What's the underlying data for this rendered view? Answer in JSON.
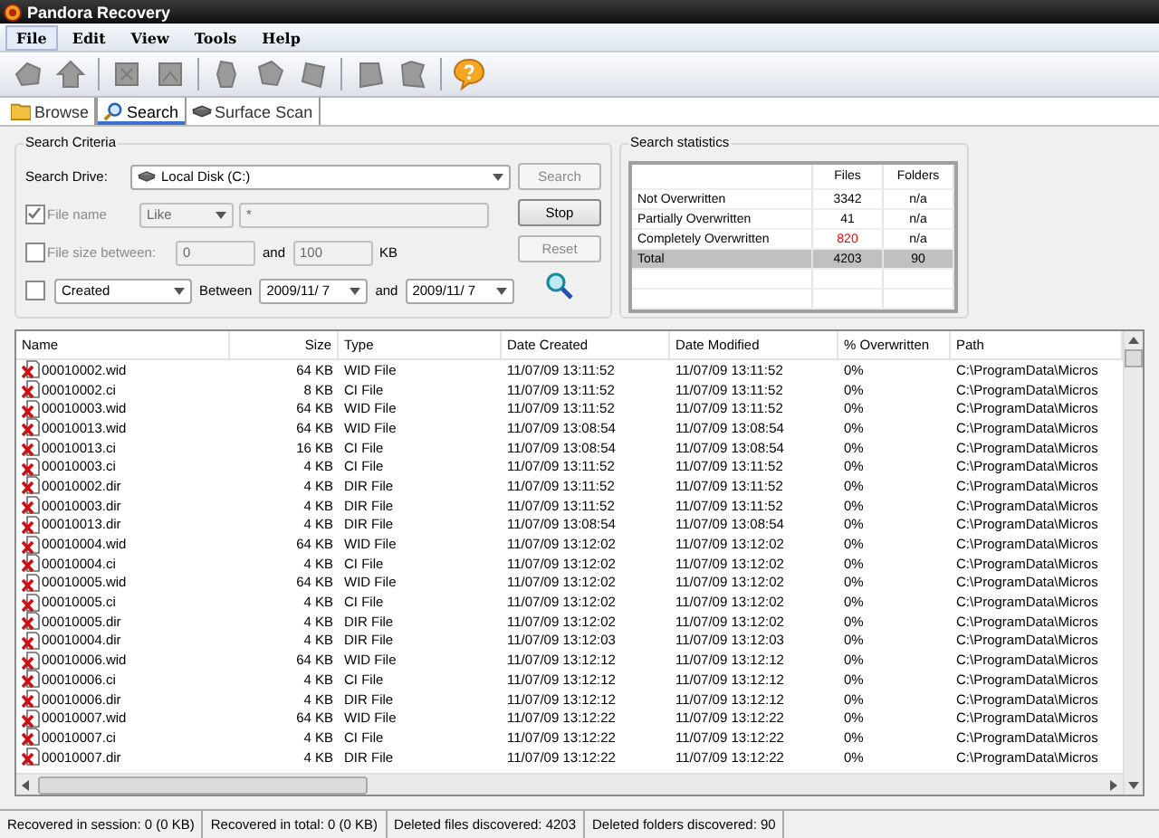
{
  "window": {
    "title": "Pandora Recovery"
  },
  "menu": [
    {
      "label": "File",
      "selected": true
    },
    {
      "label": "Edit",
      "selected": false
    },
    {
      "label": "View",
      "selected": false
    },
    {
      "label": "Tools",
      "selected": false
    },
    {
      "label": "Help",
      "selected": false
    }
  ],
  "tabs": [
    {
      "label": "Browse",
      "kind": "folder",
      "selected": false
    },
    {
      "label": "Search",
      "kind": "search",
      "selected": true
    },
    {
      "label": "Surface Scan",
      "kind": "disk",
      "selected": false
    }
  ],
  "search_criteria": {
    "title": "Search Criteria",
    "drive_label": "Search Drive:",
    "drive": "Local Disk (C:)",
    "file_name": {
      "label": "File name",
      "checked": true,
      "disabled": true,
      "match": "Like",
      "value": "*"
    },
    "file_size": {
      "label": "File size between:",
      "checked": false,
      "disabled": true,
      "min": "0",
      "and": "and",
      "max": "100",
      "unit": "KB"
    },
    "date": {
      "checked": false,
      "field": "Created",
      "between": "Between",
      "from": "2009/11/ 7",
      "and": "and",
      "to": "2009/11/ 7"
    },
    "buttons": [
      {
        "label": "Search",
        "disabled": true
      },
      {
        "label": "Stop",
        "disabled": false
      },
      {
        "label": "Reset",
        "disabled": true
      }
    ]
  },
  "search_statistics": {
    "title": "Search statistics",
    "columns": [
      "Files",
      "Folders"
    ],
    "rows": [
      {
        "label": "Not Overwritten",
        "files": "3342",
        "folders": "n/a",
        "color": "#000000",
        "selected": false
      },
      {
        "label": "Partially Overwritten",
        "files": "41",
        "folders": "n/a",
        "color": "#000000",
        "selected": false
      },
      {
        "label": "Completely Overwritten",
        "files": "820",
        "folders": "n/a",
        "color": "#ff0000",
        "selected": false
      },
      {
        "label": "Total",
        "files": "4203",
        "folders": "90",
        "color": "#000000",
        "selected": true
      }
    ]
  },
  "table": {
    "columns": [
      "Name",
      "Size",
      "Type",
      "Date Created",
      "Date Modified",
      "% Overwritten",
      "Path"
    ],
    "rows": [
      [
        "00010002.wid",
        "64 KB",
        "WID File",
        "11/07/09 13:11:52",
        "11/07/09 13:11:52",
        "0%",
        "C:\\ProgramData\\Micros"
      ],
      [
        "00010002.ci",
        "8 KB",
        "CI File",
        "11/07/09 13:11:52",
        "11/07/09 13:11:52",
        "0%",
        "C:\\ProgramData\\Micros"
      ],
      [
        "00010003.wid",
        "64 KB",
        "WID File",
        "11/07/09 13:11:52",
        "11/07/09 13:11:52",
        "0%",
        "C:\\ProgramData\\Micros"
      ],
      [
        "00010013.wid",
        "64 KB",
        "WID File",
        "11/07/09 13:08:54",
        "11/07/09 13:08:54",
        "0%",
        "C:\\ProgramData\\Micros"
      ],
      [
        "00010013.ci",
        "16 KB",
        "CI File",
        "11/07/09 13:08:54",
        "11/07/09 13:08:54",
        "0%",
        "C:\\ProgramData\\Micros"
      ],
      [
        "00010003.ci",
        "4 KB",
        "CI File",
        "11/07/09 13:11:52",
        "11/07/09 13:11:52",
        "0%",
        "C:\\ProgramData\\Micros"
      ],
      [
        "00010002.dir",
        "4 KB",
        "DIR File",
        "11/07/09 13:11:52",
        "11/07/09 13:11:52",
        "0%",
        "C:\\ProgramData\\Micros"
      ],
      [
        "00010003.dir",
        "4 KB",
        "DIR File",
        "11/07/09 13:11:52",
        "11/07/09 13:11:52",
        "0%",
        "C:\\ProgramData\\Micros"
      ],
      [
        "00010013.dir",
        "4 KB",
        "DIR File",
        "11/07/09 13:08:54",
        "11/07/09 13:08:54",
        "0%",
        "C:\\ProgramData\\Micros"
      ],
      [
        "00010004.wid",
        "64 KB",
        "WID File",
        "11/07/09 13:12:02",
        "11/07/09 13:12:02",
        "0%",
        "C:\\ProgramData\\Micros"
      ],
      [
        "00010004.ci",
        "4 KB",
        "CI File",
        "11/07/09 13:12:02",
        "11/07/09 13:12:02",
        "0%",
        "C:\\ProgramData\\Micros"
      ],
      [
        "00010005.wid",
        "64 KB",
        "WID File",
        "11/07/09 13:12:02",
        "11/07/09 13:12:02",
        "0%",
        "C:\\ProgramData\\Micros"
      ],
      [
        "00010005.ci",
        "4 KB",
        "CI File",
        "11/07/09 13:12:02",
        "11/07/09 13:12:02",
        "0%",
        "C:\\ProgramData\\Micros"
      ],
      [
        "00010005.dir",
        "4 KB",
        "DIR File",
        "11/07/09 13:12:02",
        "11/07/09 13:12:02",
        "0%",
        "C:\\ProgramData\\Micros"
      ],
      [
        "00010004.dir",
        "4 KB",
        "DIR File",
        "11/07/09 13:12:03",
        "11/07/09 13:12:03",
        "0%",
        "C:\\ProgramData\\Micros"
      ],
      [
        "00010006.wid",
        "64 KB",
        "WID File",
        "11/07/09 13:12:12",
        "11/07/09 13:12:12",
        "0%",
        "C:\\ProgramData\\Micros"
      ],
      [
        "00010006.ci",
        "4 KB",
        "CI File",
        "11/07/09 13:12:12",
        "11/07/09 13:12:12",
        "0%",
        "C:\\ProgramData\\Micros"
      ],
      [
        "00010006.dir",
        "4 KB",
        "DIR File",
        "11/07/09 13:12:12",
        "11/07/09 13:12:12",
        "0%",
        "C:\\ProgramData\\Micros"
      ],
      [
        "00010007.wid",
        "64 KB",
        "WID File",
        "11/07/09 13:12:22",
        "11/07/09 13:12:22",
        "0%",
        "C:\\ProgramData\\Micros"
      ],
      [
        "00010007.ci",
        "4 KB",
        "CI File",
        "11/07/09 13:12:22",
        "11/07/09 13:12:22",
        "0%",
        "C:\\ProgramData\\Micros"
      ],
      [
        "00010007.dir",
        "4 KB",
        "DIR File",
        "11/07/09 13:12:22",
        "11/07/09 13:12:22",
        "0%",
        "C:\\ProgramData\\Micros"
      ]
    ]
  },
  "status_bar": [
    "Recovered in session: 0 (0 KB)",
    "Recovered in total: 0 (0 KB)",
    "Deleted files discovered: 4203",
    "Deleted folders discovered: 90"
  ]
}
